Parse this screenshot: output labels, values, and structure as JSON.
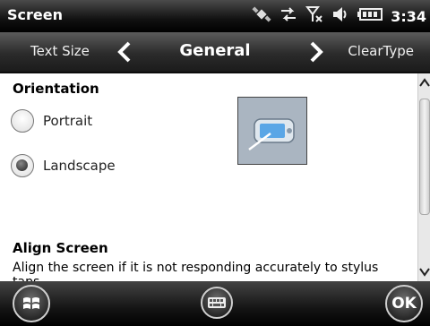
{
  "titlebar": {
    "title": "Screen",
    "clock": "3:34",
    "icons": [
      "satellite-icon",
      "sync-arrows-icon",
      "signal-off-icon",
      "volume-icon",
      "battery-icon"
    ]
  },
  "tabs": {
    "prev": "Text Size",
    "current": "General",
    "next": "ClearType"
  },
  "orientation": {
    "heading": "Orientation",
    "options": [
      {
        "label": "Portrait",
        "checked": false
      },
      {
        "label": "Landscape",
        "checked": true
      }
    ]
  },
  "align": {
    "heading": "Align Screen",
    "description": "Align the screen if it is not responding accurately to stylus taps."
  },
  "bottombar": {
    "ok_label": "OK",
    "icons": [
      "windows-start-icon",
      "keyboard-icon"
    ]
  },
  "colors": {
    "preview_bg": "#aab5c1",
    "bar_dark": "#111111"
  }
}
